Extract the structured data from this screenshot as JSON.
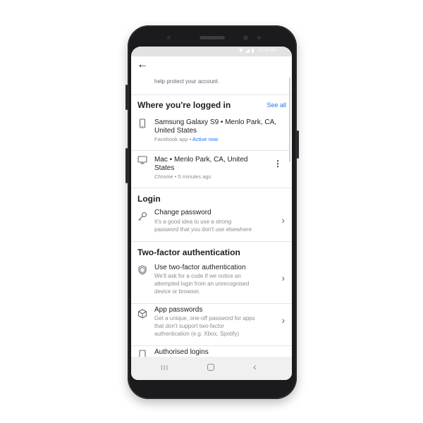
{
  "status_bar": {
    "time": "12:43 PM"
  },
  "top_bar": {
    "back_icon": "arrow-left-icon"
  },
  "intro_text": "help protect your account.",
  "logged_in": {
    "title": "Where you're logged in",
    "see_all": "See all",
    "devices": [
      {
        "name_line1": "Samsung Galaxy S9 • Menlo Park, CA,",
        "name_line2": "United States",
        "app": "Facebook app",
        "sep": " • ",
        "status": "Active now",
        "icon": "phone-icon"
      },
      {
        "name_line1": "Mac • Menlo Park, CA, United",
        "name_line2": "States",
        "app": "Chrome",
        "sep": " • ",
        "status": "5 minutes ago",
        "icon": "monitor-icon"
      }
    ]
  },
  "login": {
    "title": "Login",
    "change_password": {
      "title": "Change password",
      "desc_line1": "It's a good idea to use a strong",
      "desc_line2": "password that you don't use elsewhere",
      "icon": "key-icon"
    }
  },
  "two_factor": {
    "title": "Two-factor authentication",
    "items": [
      {
        "title": "Use two-factor authentication",
        "desc_line1": "We'll ask for a code if we notice an",
        "desc_line2": "attempted login from an unrecognised",
        "desc_line3": "device or browser.",
        "icon": "shield-icon"
      },
      {
        "title": "App passwords",
        "desc_line1": "Get a unique, one-off password for apps",
        "desc_line2": "that don't support two-factor",
        "desc_line3": "authentication (e.g. Xbox, Spotify)",
        "icon": "cube-icon"
      },
      {
        "title": "Authorised logins",
        "icon": "device-icon"
      }
    ]
  },
  "nav": {
    "recent": "III",
    "home": "home-icon",
    "back": "‹"
  }
}
